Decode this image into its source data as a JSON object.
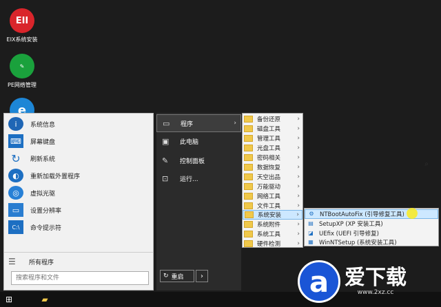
{
  "desktop": {
    "icons": [
      {
        "label": "EIX系统安装",
        "glyph": "EII"
      },
      {
        "label": "PE网络管理",
        "glyph": "✎"
      },
      {
        "label": "",
        "glyph": "e"
      }
    ]
  },
  "start_menu": {
    "left_items": [
      {
        "label": "系统信息",
        "icon": "info-icon"
      },
      {
        "label": "屏幕键盘",
        "icon": "keyboard-icon"
      },
      {
        "label": "刷新系统",
        "icon": "refresh-icon"
      },
      {
        "label": "重新加载外置程序",
        "icon": "reload-icon"
      },
      {
        "label": "虚拟光驱",
        "icon": "cd-icon"
      },
      {
        "label": "设置分辨率",
        "icon": "display-icon"
      },
      {
        "label": "命令提示符",
        "icon": "cmd-icon"
      }
    ],
    "all_programs": "所有程序",
    "search_placeholder": "搜索程序和文件",
    "right_items": [
      {
        "label": "程序",
        "icon": "programs-icon"
      },
      {
        "label": "此电脑",
        "icon": "computer-icon"
      },
      {
        "label": "控制面板",
        "icon": "control-panel-icon"
      },
      {
        "label": "运行...",
        "icon": "run-icon"
      }
    ],
    "power_label": "重启"
  },
  "submenu_programs": [
    "备份还原",
    "磁盘工具",
    "管理工具",
    "光盘工具",
    "密码相关",
    "数据恢复",
    "天空出品",
    "万能驱动",
    "网络工具",
    "文件工具",
    "系统安装",
    "系统附件",
    "系统工具",
    "硬件检测"
  ],
  "submenu_install": [
    "NTBootAutoFix (引导修复工具)",
    "SetupXP (XP 安装工具)",
    "UEfix (UEFI 引导修复)",
    "WinNTSetup (系统安装工具)"
  ],
  "watermark": {
    "title": "爱下载",
    "url": "www.2xz.cc"
  },
  "colors": {
    "accent": "#1d6fc2",
    "folder": "#f0c84a",
    "highlight": "#cde8ff"
  }
}
